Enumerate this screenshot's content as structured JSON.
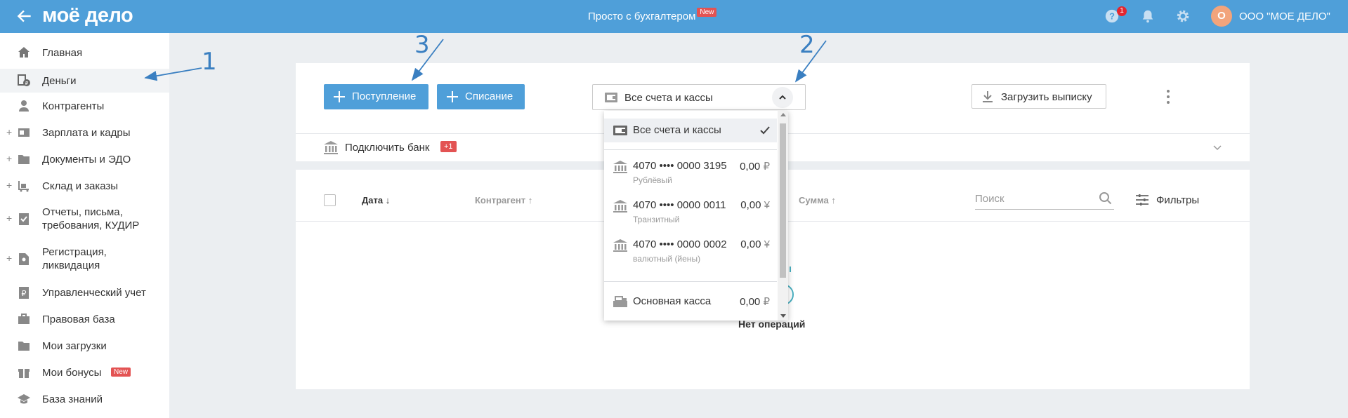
{
  "topbar": {
    "logo": "моё дело",
    "promo": "Просто с бухгалтером",
    "promo_badge": "New",
    "help_badge": "1",
    "avatar_letter": "О",
    "company": "ООО \"МОЕ ДЕЛО\""
  },
  "sidebar": {
    "items": [
      {
        "label": "Главная",
        "icon": "home-icon"
      },
      {
        "label": "Деньги",
        "icon": "money-icon"
      },
      {
        "label": "Контрагенты",
        "icon": "contractors-icon"
      },
      {
        "label": "Зарплата и кадры",
        "icon": "salary-icon"
      },
      {
        "label": "Документы и ЭДО",
        "icon": "folder-icon"
      },
      {
        "label": "Склад и заказы",
        "icon": "warehouse-icon"
      },
      {
        "label": "Отчеты, письма, требования, КУДИР",
        "icon": "reports-icon"
      },
      {
        "label": "Регистрация, ликвидация",
        "icon": "registration-icon"
      },
      {
        "label": "Управленческий учет",
        "icon": "management-icon"
      },
      {
        "label": "Правовая база",
        "icon": "briefcase-icon"
      },
      {
        "label": "Мои загрузки",
        "icon": "folder-icon"
      },
      {
        "label": "Мои бонусы",
        "icon": "gift-icon",
        "badge": "New"
      },
      {
        "label": "База знаний",
        "icon": "graduation-icon"
      }
    ]
  },
  "toolbar": {
    "income_label": "Поступление",
    "expense_label": "Списание",
    "account_select": "Все счета и кассы",
    "upload_label": "Загрузить выписку"
  },
  "bank": {
    "label": "Подключить банк",
    "badge": "+1"
  },
  "table": {
    "col_date": "Дата ↓",
    "col_contractor": "Контрагент ↑",
    "col_sum": "Сумма ↑",
    "search_placeholder": "Поиск",
    "filters_label": "Фильтры",
    "empty": "Нет операций"
  },
  "dropdown": {
    "all": "Все счета и кассы",
    "accounts": [
      {
        "number": "4070 •••• 0000 3195",
        "sub": "Рублёвый",
        "amount": "0,00",
        "currency": "₽"
      },
      {
        "number": "4070 •••• 0000 0011",
        "sub": "Транзитный",
        "amount": "0,00",
        "currency": "¥"
      },
      {
        "number": "4070 •••• 0000 0002",
        "sub": "валютный (йены)",
        "amount": "0,00",
        "currency": "¥"
      }
    ],
    "cash": {
      "name": "Основная касса",
      "amount": "0,00",
      "currency": "₽"
    }
  },
  "annotations": {
    "n1": "1",
    "n2": "2",
    "n3": "3"
  },
  "colors": {
    "brand": "#4f9fd9",
    "badge_red": "#e35353",
    "annotation_blue": "#3a7fc1"
  }
}
